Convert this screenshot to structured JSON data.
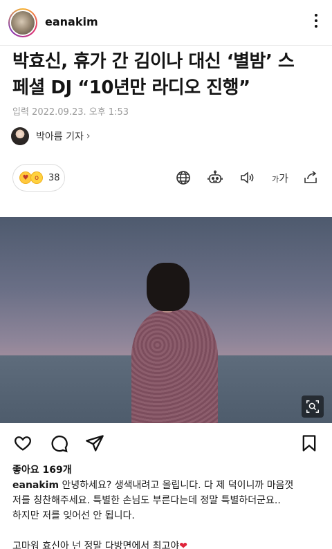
{
  "post": {
    "username": "eanakim",
    "likes_label": "좋아요 169개",
    "caption": {
      "username": "eanakim",
      "line1": " 안녕하세요? 생색내려고 올립니다. 다 제 덕이니까 마음껏",
      "line2": "저를 칭찬해주세요. 특별한 손님도 부른다는데 정말 특별하더군요..",
      "line3": "하지만 저를 잊어선 안 됩니다.",
      "line4": "고마워 효신아 넌 정말 다방면에서 최고야",
      "heart": "❤"
    }
  },
  "article": {
    "headline_line1": "박효신, 휴가 간 김이나 대신 ‘별밤’ 스",
    "headline_line2": "페셜 DJ “10년만 라디오 진행”",
    "date": "입력 2022.09.23. 오후 1:53",
    "reporter": "박아름 기자",
    "reporter_chevron": "›",
    "reaction_count": "38",
    "font_size_label_small": "가",
    "font_size_label_big": "가"
  },
  "icons": {
    "more": "more-icon",
    "globe": "globe-icon",
    "robot": "robot-icon",
    "speaker": "speaker-icon",
    "share": "share-icon",
    "zoom": "search-icon",
    "heart": "heart-icon",
    "comment": "comment-icon",
    "send": "send-icon",
    "bookmark": "bookmark-icon"
  },
  "colors": {
    "heart_red": "#e0243a",
    "muted_text": "#9a9a9a"
  }
}
